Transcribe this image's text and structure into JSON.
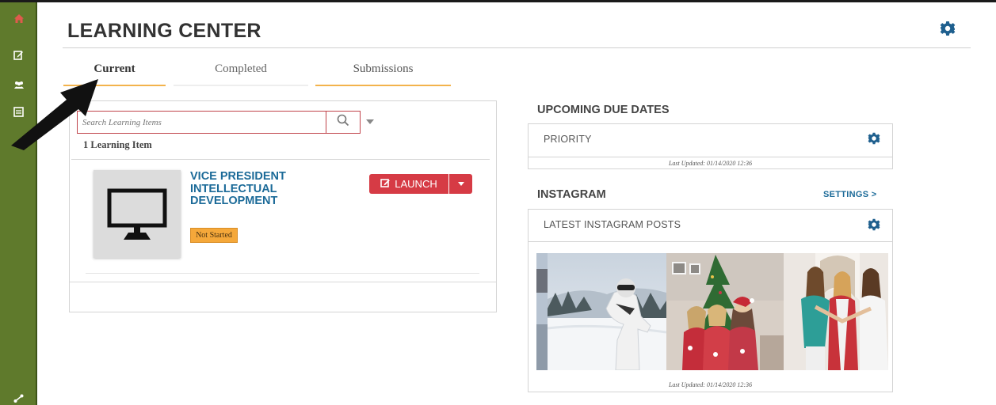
{
  "header": {
    "title": "LEARNING CENTER"
  },
  "tabs": [
    {
      "label": "Current",
      "active": true
    },
    {
      "label": "Completed",
      "active": false
    },
    {
      "label": "Submissions",
      "active": false
    }
  ],
  "learning": {
    "search_placeholder": "Search Learning Items",
    "count_label": "1 Learning Item",
    "items": [
      {
        "title": "VICE PRESIDENT INTELLECTUAL DEVELOPMENT",
        "status": "Not Started",
        "launch_label": "LAUNCH",
        "icon": "monitor-icon"
      }
    ]
  },
  "upcoming": {
    "section_title": "UPCOMING DUE DATES",
    "card_title": "PRIORITY",
    "updated": "Last Updated: 01/14/2020 12:36"
  },
  "instagram": {
    "section_title": "INSTAGRAM",
    "settings_link": "SETTINGS >",
    "card_title": "LATEST INSTAGRAM POSTS",
    "updated": "Last Updated: 01/14/2020 12:36",
    "post_count": 3
  },
  "colors": {
    "sidebar": "#5f7a2c",
    "accent_link": "#1b6a98",
    "launch": "#d63b45",
    "tab_underline": "#f3b34c",
    "status_badge": "#f5a83a",
    "gear": "#1e5f8e"
  },
  "icons": {
    "rail": [
      "home-icon",
      "edit-icon",
      "people-icon",
      "document-icon",
      "share-icon"
    ],
    "settings": "gear-icon",
    "search": "search-icon"
  }
}
